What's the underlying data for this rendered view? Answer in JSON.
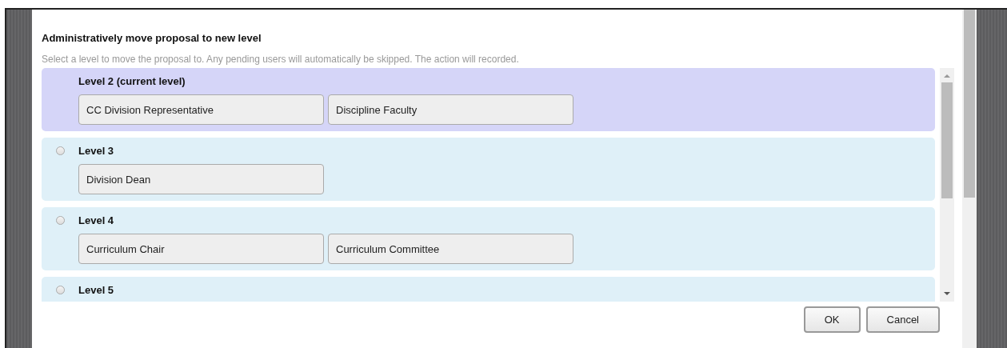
{
  "dialog": {
    "title": "Administratively move proposal to new level",
    "description": "Select a level to move the proposal to. Any pending users will automatically be skipped. The action will recorded.",
    "levels": [
      {
        "label": "Level 2 (current level)",
        "current": true,
        "roles": [
          "CC Division Representative",
          "Discipline Faculty"
        ]
      },
      {
        "label": "Level 3",
        "current": false,
        "selected": false,
        "roles": [
          "Division Dean"
        ]
      },
      {
        "label": "Level 4",
        "current": false,
        "selected": false,
        "roles": [
          "Curriculum Chair",
          "Curriculum Committee"
        ]
      },
      {
        "label": "Level 5",
        "current": false,
        "selected": false
      }
    ],
    "buttons": [
      "OK",
      "Cancel"
    ]
  }
}
